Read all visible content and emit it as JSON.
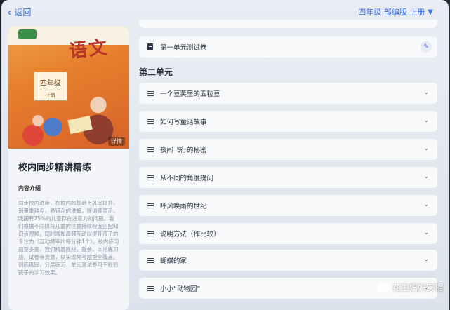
{
  "header": {
    "back_label": "返回",
    "grade_label": "四年级 部编版 上册"
  },
  "book": {
    "cover_title": "语文",
    "cover_grade": "四年级",
    "cover_volume": "上册",
    "detail_label": "详情",
    "title": "校内同步精讲精练",
    "intro_heading": "内容介绍",
    "intro_text": "同步校内进度，在校内的基础上巩固提升，销量重难点，易错点的讲解，提训查显示，我国有75%的儿童存在注意力的问题。我们根据不同阶段儿童的注意持续程度匹配知识点视频，同时增加高频互动以提升孩子的专注力（互动频率约每分钟1个）。校内练习题型多变，我们精选教材，教参、本地练习册、试卷等资源，以实现常考题型全覆盖。例练巩固，分层练习，单元测试卷用于检验孩子的学习效果。"
  },
  "unit_test": {
    "label": "第一单元测试卷"
  },
  "unit2": {
    "title": "第二单元",
    "lessons": [
      {
        "label": "一个豆荚里的五粒豆"
      },
      {
        "label": "如何写童话故事"
      },
      {
        "label": "夜间飞行的秘密"
      },
      {
        "label": "从不同的角度提问"
      },
      {
        "label": "呼风唤雨的世纪"
      },
      {
        "label": "说明方法（作比较）"
      },
      {
        "label": "蝴蝶的家"
      },
      {
        "label": "小小“动物园”"
      }
    ]
  },
  "watermark": {
    "text": "花生妈妈安相"
  },
  "colors": {
    "accent": "#3a6fe0",
    "panel": "#f8f9fb",
    "background": "#e2e7ef"
  }
}
